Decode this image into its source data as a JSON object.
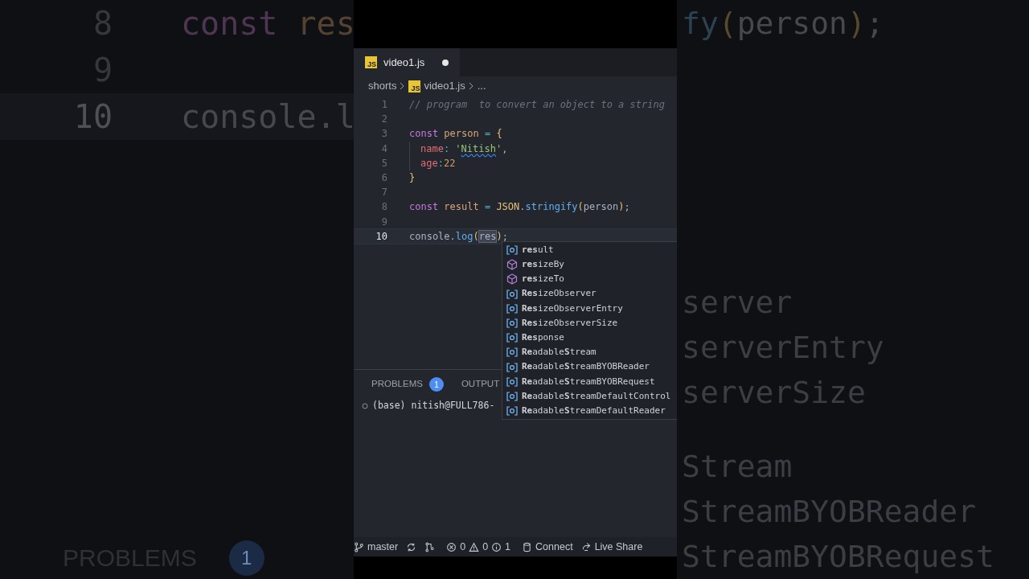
{
  "backdrop_left": {
    "lines": [
      {
        "number": "8",
        "active": false,
        "tokens": [
          {
            "kind": "keyword",
            "text": "const "
          },
          {
            "kind": "declaration",
            "text": "res"
          }
        ]
      },
      {
        "number": "9",
        "active": false
      },
      {
        "number": "10",
        "active": true,
        "tokens": [
          {
            "kind": "plain",
            "text": "console.l"
          }
        ]
      }
    ],
    "panel_tab": "PROBLEMS",
    "badge": "1"
  },
  "editor": {
    "tab": {
      "icon_text": "JS",
      "label": "video1.js",
      "selected": true,
      "modified": true
    },
    "breadcrumb": [
      {
        "kind": "folder",
        "label": "shorts"
      },
      {
        "kind": "file",
        "icon_text": "JS",
        "label": "video1.js"
      },
      {
        "kind": "more",
        "label": "..."
      }
    ],
    "lines": [
      {
        "number": "1",
        "active": false,
        "tokens": [
          {
            "kind": "comment",
            "text": "// program  to convert an object to a string"
          }
        ]
      },
      {
        "number": "2",
        "active": false
      },
      {
        "number": "3",
        "active": false,
        "tokens": [
          {
            "kind": "keyword",
            "text": "const "
          },
          {
            "kind": "declaration",
            "text": "person "
          },
          {
            "kind": "operator",
            "text": "= "
          },
          {
            "kind": "bracket",
            "text": "{"
          }
        ]
      },
      {
        "number": "4",
        "active": false,
        "indented": true,
        "tokens": [
          {
            "kind": "property",
            "text": "name"
          },
          {
            "kind": "operator",
            "text": ": "
          },
          {
            "kind": "string",
            "text": "'"
          },
          {
            "kind": "string",
            "text": "Nitish",
            "squiggle": true
          },
          {
            "kind": "string",
            "text": "'"
          },
          {
            "kind": "plain",
            "text": ","
          }
        ]
      },
      {
        "number": "5",
        "active": false,
        "indented": true,
        "tokens": [
          {
            "kind": "property",
            "text": "age"
          },
          {
            "kind": "operator",
            "text": ":"
          },
          {
            "kind": "number",
            "text": "22"
          }
        ]
      },
      {
        "number": "6",
        "active": false,
        "tokens": [
          {
            "kind": "bracket",
            "text": "}"
          }
        ]
      },
      {
        "number": "7",
        "active": false
      },
      {
        "number": "8",
        "active": false,
        "tokens": [
          {
            "kind": "keyword",
            "text": "const "
          },
          {
            "kind": "declaration",
            "text": "result "
          },
          {
            "kind": "operator",
            "text": "= "
          },
          {
            "kind": "class",
            "text": "JSON"
          },
          {
            "kind": "plain",
            "text": "."
          },
          {
            "kind": "function",
            "text": "stringify"
          },
          {
            "kind": "bracket",
            "text": "("
          },
          {
            "kind": "plain",
            "text": "person"
          },
          {
            "kind": "bracket",
            "text": ")"
          },
          {
            "kind": "plain",
            "text": ";"
          }
        ]
      },
      {
        "number": "9",
        "active": false
      },
      {
        "number": "10",
        "active": true,
        "tokens": [
          {
            "kind": "plain",
            "text": "console"
          },
          {
            "kind": "plain",
            "text": "."
          },
          {
            "kind": "function",
            "text": "log"
          },
          {
            "kind": "bracket",
            "text": "("
          },
          {
            "kind": "plain",
            "text": "res",
            "highlighted": true
          },
          {
            "kind": "bracket",
            "text": ")"
          },
          {
            "kind": "plain",
            "text": ";"
          }
        ]
      }
    ]
  },
  "suggestions": [
    {
      "kind": "variable",
      "label": "**res**ult"
    },
    {
      "kind": "method",
      "label": "**res**izeBy"
    },
    {
      "kind": "method",
      "label": "**res**izeTo"
    },
    {
      "kind": "variable",
      "label": "**Res**izeObserver"
    },
    {
      "kind": "variable",
      "label": "**Res**izeObserverEntry"
    },
    {
      "kind": "variable",
      "label": "**Res**izeObserverSize"
    },
    {
      "kind": "variable",
      "label": "**Res**ponse"
    },
    {
      "kind": "variable",
      "label": "**Re**adable**S**tream"
    },
    {
      "kind": "variable",
      "label": "**Re**adable**S**treamBYOBReader"
    },
    {
      "kind": "variable",
      "label": "**Re**adable**S**treamBYOBRequest"
    },
    {
      "kind": "variable",
      "label": "**Re**adable**S**treamDefaultControl"
    },
    {
      "kind": "variable",
      "label": "**Re**adable**S**treamDefaultReader"
    }
  ],
  "panel": {
    "tabs": [
      {
        "label": "PROBLEMS",
        "badge": "1"
      },
      {
        "label": "OUTPUT"
      }
    ],
    "terminal_line": "(base) nitish@FULL786-"
  },
  "status_bar": [
    {
      "kind": "branch",
      "label": "master"
    },
    {
      "kind": "sync"
    },
    {
      "kind": "graph"
    },
    {
      "kind": "errors",
      "label": "0"
    },
    {
      "kind": "warnings",
      "label": "0"
    },
    {
      "kind": "info",
      "label": "1"
    },
    {
      "kind": "database",
      "label": "Connect"
    },
    {
      "kind": "share",
      "label": "Live Share"
    }
  ],
  "backdrop_right": {
    "first_line": [
      {
        "kind": "function",
        "text": "fy"
      },
      {
        "kind": "bracket",
        "text": "("
      },
      {
        "kind": "plain",
        "text": "person"
      },
      {
        "kind": "bracket",
        "text": ")"
      },
      {
        "kind": "plain",
        "text": ";"
      }
    ],
    "groups": [
      [
        "server",
        "serverEntry",
        "serverSize"
      ],
      [
        "Stream",
        "StreamBYOBReader",
        "StreamBYOBRequest"
      ]
    ]
  }
}
